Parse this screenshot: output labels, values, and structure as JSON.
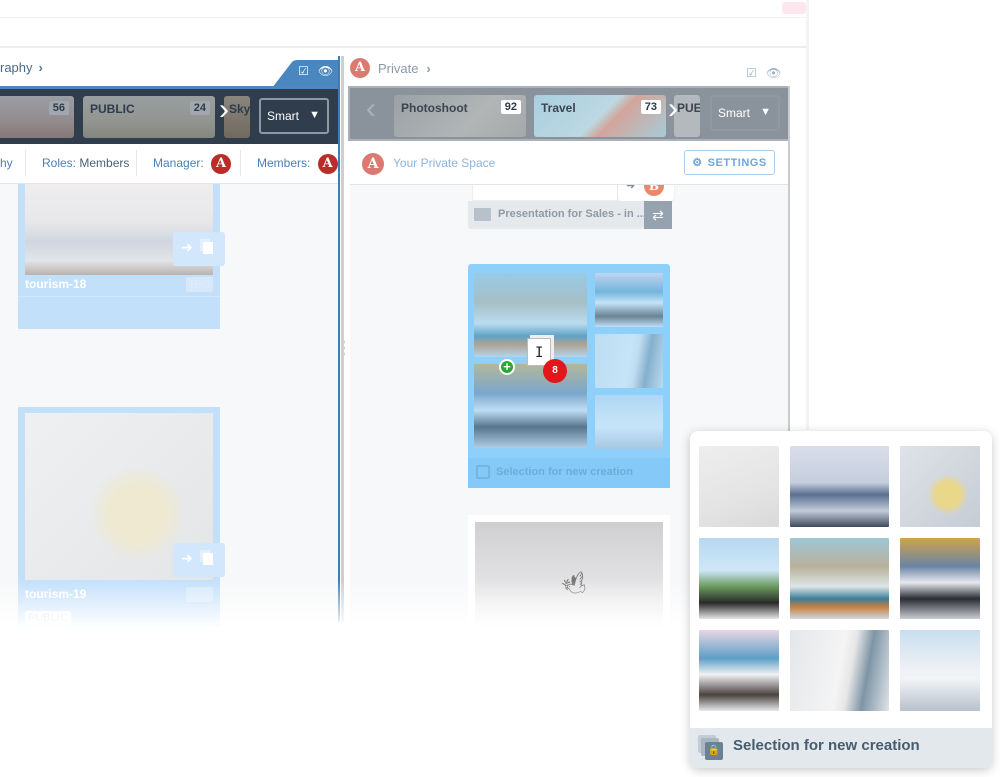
{
  "top_bar": {
    "tab_chip_color": "#fde6ee"
  },
  "left_panel": {
    "breadcrumb": "raphy",
    "breadcrumb_chevron": "›",
    "header_icons": [
      "checkbox-icon",
      "eye-icon"
    ],
    "collections": [
      {
        "title": "",
        "count": "56"
      },
      {
        "title": "PUBLIC",
        "count": "24"
      },
      {
        "title": "Sky",
        "count": ""
      }
    ],
    "next_arrow": "›",
    "sort_select": {
      "value": "Smart",
      "chevron": "⌄"
    },
    "info": {
      "truncated": "hy",
      "roles_label": "Roles:",
      "roles_value": "Members",
      "manager_label": "Manager:",
      "members_label": "Members:",
      "avatar_letter": "A"
    },
    "assets": [
      {
        "name": "tourism-18",
        "ext": "JPG",
        "badge": ""
      },
      {
        "name": "tourism-19",
        "ext": "JPG",
        "badge": "PUBLIC"
      }
    ],
    "accent_color": "#3e7db6"
  },
  "right_panel": {
    "breadcrumb": "Private",
    "breadcrumb_chevron": "›",
    "avatar_letter": "A",
    "header_icons": [
      "checkbox-icon",
      "eye-icon"
    ],
    "prev_arrow": "‹",
    "collections": [
      {
        "title": "Photoshoot",
        "count": "92"
      },
      {
        "title": "Travel",
        "count": "73"
      },
      {
        "title": "PUE",
        "count": ""
      }
    ],
    "next_arrow": "›",
    "sort_select": {
      "value": "Smart",
      "chevron": "⌄"
    },
    "space_name": "Your Private Space",
    "settings_label": "SETTINGS",
    "presentation": {
      "label": "Presentation for Sales - in ...",
      "share_avatar": "B"
    },
    "selection_card": {
      "label": "Selection for new creation"
    },
    "drag": {
      "count": "8",
      "plus": "+"
    }
  },
  "drag_preview": {
    "title": "Selection for new creation",
    "photos": [
      "laptop-on-desk",
      "cliff-diver-over-sea",
      "map-with-pins",
      "woman-at-eiffel-tower",
      "beach-umbrella-books-sunglasses",
      "traveler-at-airport-board",
      "santorini-terrace",
      "sailboat-deck",
      "white-village-hillside"
    ]
  }
}
